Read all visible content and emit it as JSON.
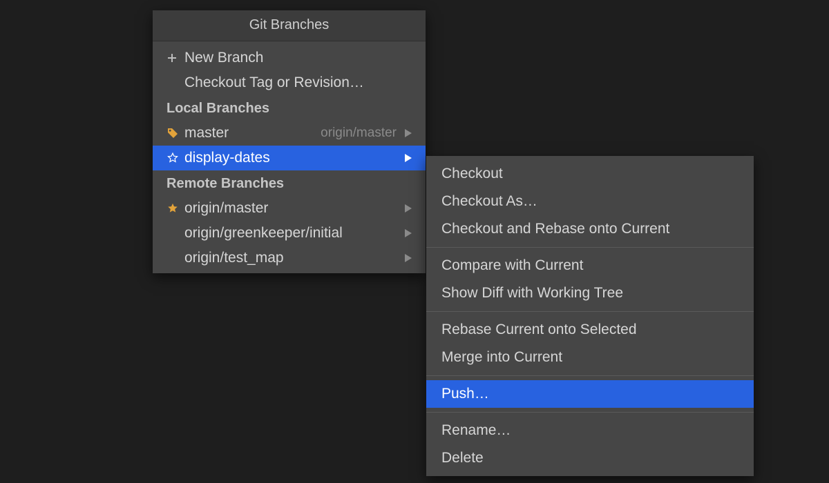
{
  "colors": {
    "selected": "#2862e0",
    "panel": "#464646",
    "title_bar": "#3c3c3c"
  },
  "popup_a": {
    "title": "Git Branches",
    "top_actions": [
      {
        "id": "new-branch",
        "label": "New Branch",
        "icon": "plus"
      },
      {
        "id": "checkout-tag",
        "label": "Checkout Tag or Revision…",
        "icon": ""
      }
    ],
    "local_header": "Local Branches",
    "local_branches": [
      {
        "name": "master",
        "tracking": "origin/master",
        "icon": "tag",
        "submenu": true,
        "selected": false
      },
      {
        "name": "display-dates",
        "tracking": "",
        "icon": "star-outline",
        "submenu": true,
        "selected": true
      }
    ],
    "remote_header": "Remote Branches",
    "remote_branches": [
      {
        "name": "origin/master",
        "icon": "star-filled",
        "submenu": true
      },
      {
        "name": "origin/greenkeeper/initial",
        "icon": "",
        "submenu": true
      },
      {
        "name": "origin/test_map",
        "icon": "",
        "submenu": true
      }
    ]
  },
  "popup_b": {
    "groups": [
      [
        {
          "id": "checkout",
          "label": "Checkout"
        },
        {
          "id": "checkout-as",
          "label": "Checkout As…"
        },
        {
          "id": "checkout-rebase",
          "label": "Checkout and Rebase onto Current"
        }
      ],
      [
        {
          "id": "compare",
          "label": "Compare with Current"
        },
        {
          "id": "diff-tree",
          "label": "Show Diff with Working Tree"
        }
      ],
      [
        {
          "id": "rebase-onto",
          "label": "Rebase Current onto Selected"
        },
        {
          "id": "merge",
          "label": "Merge into Current"
        }
      ],
      [
        {
          "id": "push",
          "label": "Push…",
          "selected": true
        }
      ],
      [
        {
          "id": "rename",
          "label": "Rename…"
        },
        {
          "id": "delete",
          "label": "Delete"
        }
      ]
    ]
  }
}
